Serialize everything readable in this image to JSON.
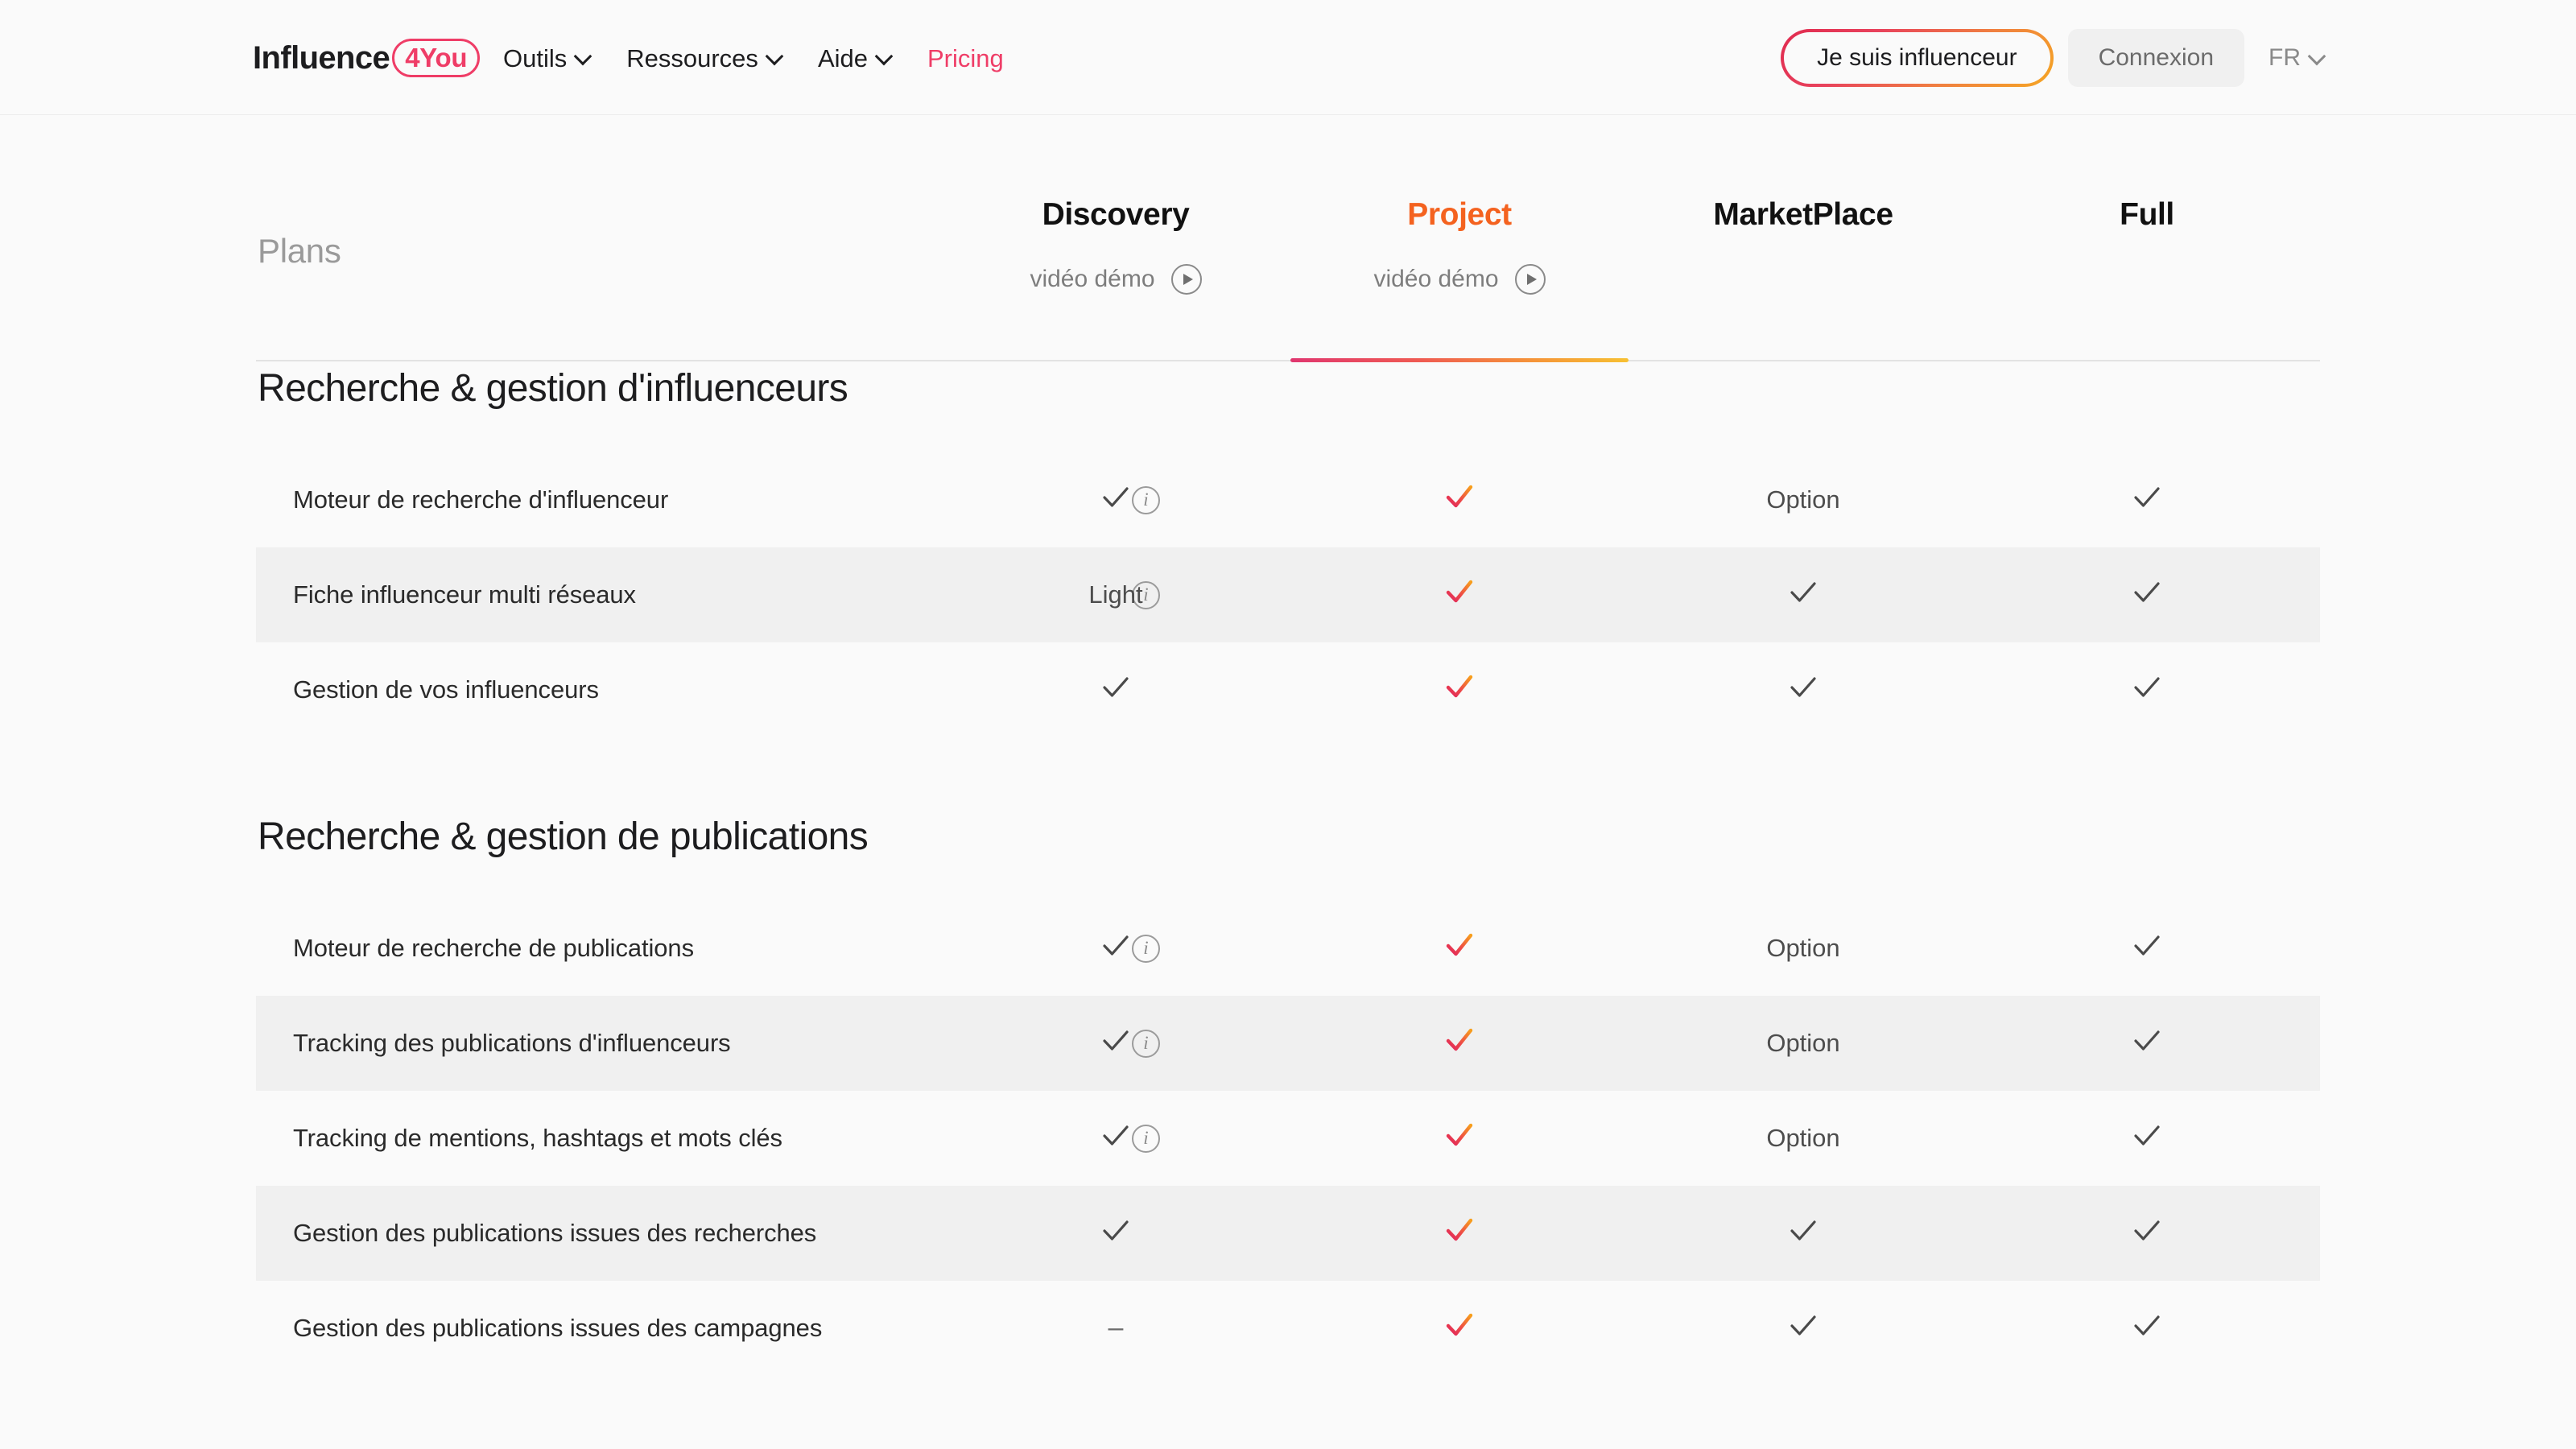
{
  "brand": {
    "word": "Influence",
    "badge": "4You"
  },
  "nav": [
    {
      "label": "Outils",
      "caret": true,
      "accent": false,
      "icon": "chevron-down-icon"
    },
    {
      "label": "Ressources",
      "caret": true,
      "accent": false,
      "icon": "chevron-down-icon"
    },
    {
      "label": "Aide",
      "caret": true,
      "accent": false,
      "icon": "chevron-down-icon"
    },
    {
      "label": "Pricing",
      "caret": false,
      "accent": true,
      "icon": ""
    }
  ],
  "header_actions": {
    "influencer_button": "Je suis influenceur",
    "login_button": "Connexion",
    "language": "FR",
    "language_icon": "chevron-down-icon"
  },
  "table": {
    "plans_label": "Plans",
    "demo_label": "vidéo démo",
    "play_icon": "play-circle-icon",
    "info_icon": "info-circle-icon",
    "check_icon": "check-icon",
    "dash_glyph": "–",
    "columns": [
      {
        "name": "Discovery",
        "highlight": false,
        "has_demo": true,
        "active": false
      },
      {
        "name": "Project",
        "highlight": true,
        "has_demo": true,
        "active": true
      },
      {
        "name": "MarketPlace",
        "highlight": false,
        "has_demo": false,
        "active": false
      },
      {
        "name": "Full",
        "highlight": false,
        "has_demo": false,
        "active": false
      }
    ],
    "sections": [
      {
        "title": "Recherche & gestion d'influenceurs",
        "rows": [
          {
            "feature": "Moteur de recherche d'influenceur",
            "info": true,
            "cells": [
              "check",
              "check-gradient",
              "Option",
              "check"
            ]
          },
          {
            "feature": "Fiche influenceur multi réseaux",
            "info": true,
            "cells": [
              "Light",
              "check-gradient",
              "check",
              "check"
            ]
          },
          {
            "feature": "Gestion de vos influenceurs",
            "info": false,
            "cells": [
              "check",
              "check-gradient",
              "check",
              "check"
            ]
          }
        ]
      },
      {
        "title": "Recherche & gestion de publications",
        "rows": [
          {
            "feature": "Moteur de recherche de publications",
            "info": true,
            "cells": [
              "check",
              "check-gradient",
              "Option",
              "check"
            ]
          },
          {
            "feature": "Tracking des publications d'influenceurs",
            "info": true,
            "cells": [
              "check",
              "check-gradient",
              "Option",
              "check"
            ]
          },
          {
            "feature": "Tracking de mentions, hashtags et mots clés",
            "info": true,
            "cells": [
              "check",
              "check-gradient",
              "Option",
              "check"
            ]
          },
          {
            "feature": "Gestion des publications issues des recherches",
            "info": false,
            "cells": [
              "check",
              "check-gradient",
              "check",
              "check"
            ]
          },
          {
            "feature": "Gestion des publications issues des campagnes",
            "info": false,
            "cells": [
              "dash",
              "check-gradient",
              "check",
              "check"
            ]
          }
        ]
      }
    ]
  },
  "colors": {
    "brand_pink": "#ef3d67",
    "accent_orange": "#f4621f",
    "gradient_start": "#e0366f",
    "gradient_end": "#f7c032",
    "page_bg": "#fafafa",
    "zebra_bg": "#f0f0f0",
    "text_dark": "#1d1d1f",
    "text_muted": "#8a8a8a"
  }
}
